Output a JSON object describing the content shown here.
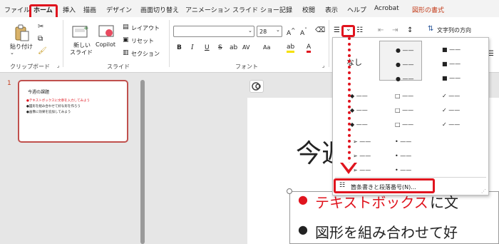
{
  "tabs": [
    "ファイル",
    "ホーム",
    "挿入",
    "描画",
    "デザイン",
    "画面切り替え",
    "アニメーション",
    "スライド ショー",
    "記録",
    "校閲",
    "表示",
    "ヘルプ",
    "Acrobat",
    "図形の書式"
  ],
  "ribbon": {
    "paste": "貼り付け",
    "clipboard": "クリップボード",
    "new_slide_1": "新しい",
    "new_slide_2": "スライド",
    "copilot": "Copilot",
    "layout": "レイアウト",
    "reset": "リセット",
    "section": "セクション",
    "slides": "スライド",
    "font_size": "28",
    "font": "フォント",
    "bold": "B",
    "italic": "I",
    "underline": "U",
    "strike": "S",
    "spacing": "AV",
    "case": "Aa",
    "clear": "A",
    "highlight": "ab",
    "color": "A",
    "text_dir": "文字列の方向"
  },
  "thumbnail": {
    "number": "1",
    "title": "今週の課題",
    "lines": [
      "●テキストボックスに文章を入力してみよう",
      "●図形を組み合わせて好な形を作ろう",
      "●画像に効果を追加してみよう"
    ]
  },
  "slide": {
    "title": "今週",
    "line1_red": "テキストボックス",
    "line1_black": "に文",
    "line2": "図形を組み合わせて好"
  },
  "dropdown": {
    "none": "なし",
    "command": "箇条書きと段落番号(N)..."
  },
  "colors": {
    "accent": "#c43e1c",
    "highlight": "#e0141e",
    "bullet_red": "#e0141e"
  }
}
